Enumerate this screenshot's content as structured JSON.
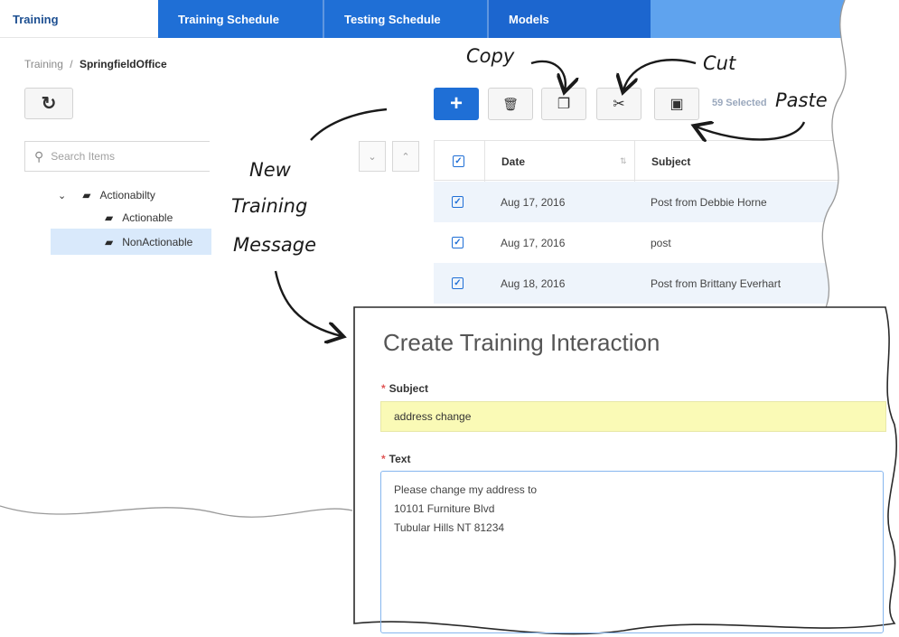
{
  "tabs": [
    "Training",
    "Training Schedule",
    "Testing Schedule",
    "Models"
  ],
  "breadcrumb": {
    "root": "Training",
    "separator": "/",
    "current": "SpringfieldOffice"
  },
  "icons": {
    "refresh": "↻",
    "add": "+",
    "delete": "🗑",
    "copy": "❐",
    "cut": "✂",
    "paste": "▣",
    "search": "⚲",
    "chevron_down": "⌄",
    "chevron_up": "⌃",
    "tree_expand": "⌄",
    "folder": "▰",
    "checkbox": "✓",
    "sort": "⇅"
  },
  "toolbar": {
    "selected_count": "59 Selected"
  },
  "search": {
    "placeholder": "Search Items"
  },
  "tree": {
    "items": [
      {
        "label": "Actionabilty",
        "selected": false
      },
      {
        "label": "Actionable",
        "selected": false
      },
      {
        "label": "NonActionable",
        "selected": true
      }
    ]
  },
  "grid": {
    "columns": [
      "Date",
      "Subject"
    ],
    "rows": [
      {
        "date": "Aug 17, 2016",
        "subject": "Post from Debbie Horne"
      },
      {
        "date": "Aug 17, 2016",
        "subject": "post"
      },
      {
        "date": "Aug 18, 2016",
        "subject": "Post from Brittany Everhart"
      }
    ]
  },
  "annotations": {
    "copy": "Copy",
    "cut": "Cut",
    "paste": "Paste",
    "new_training_1": "New",
    "new_training_2": "Training",
    "new_training_3": "Message"
  },
  "dialog": {
    "title": "Create Training Interaction",
    "required_mark": "*",
    "subject_label": "Subject",
    "subject_value": "address change",
    "text_label": "Text",
    "text_lines": [
      "Please change my address to",
      "10101 Furniture Blvd",
      "Tubular Hills NT 81234"
    ]
  },
  "colors": {
    "primary": "#1f6fd6",
    "highlight": "#fafab6",
    "row_alt": "#eef4fb",
    "selected_tree": "#d9e9fb",
    "required": "#e05555"
  }
}
